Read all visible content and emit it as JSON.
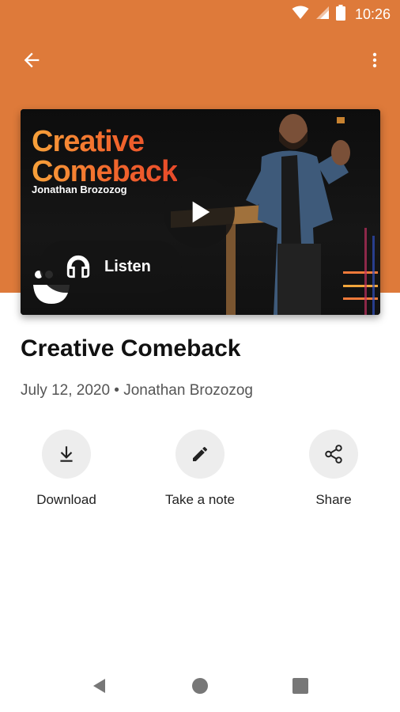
{
  "status_bar": {
    "time": "10:26",
    "icons": [
      "wifi-icon",
      "signal-icon",
      "battery-icon"
    ]
  },
  "app_bar": {
    "back_icon": "arrow-left-icon",
    "menu_icon": "more-vert-icon"
  },
  "video": {
    "thumbnail_title_line1": "Creative",
    "thumbnail_title_line2": "Comeback",
    "thumbnail_speaker": "Jonathan Brozozog",
    "play_icon": "play-icon",
    "listen_label": "Listen",
    "listen_icon": "headphones-icon"
  },
  "sermon": {
    "title": "Creative Comeback",
    "meta": "July 12, 2020 • Jonathan Brozozog"
  },
  "actions": [
    {
      "label": "Download",
      "icon": "download-icon"
    },
    {
      "label": "Take a note",
      "icon": "pencil-icon"
    },
    {
      "label": "Share",
      "icon": "share-icon"
    }
  ],
  "colors": {
    "header": "#DE7A3A",
    "action_bg": "#EDEDED",
    "title_gradient_start": "#F7A23A",
    "title_gradient_end": "#E84A2A"
  }
}
